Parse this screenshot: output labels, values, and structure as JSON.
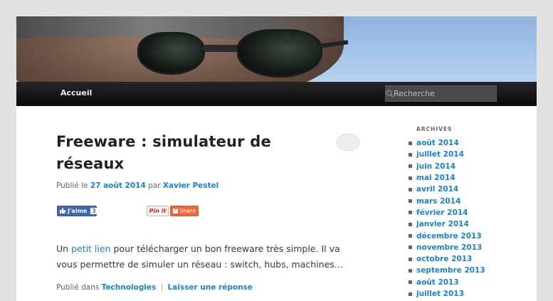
{
  "nav": {
    "home_label": "Accueil",
    "search_placeholder": "Recherche"
  },
  "post": {
    "title": "Freeware : simulateur de réseaux",
    "meta_prefix": "Publié le",
    "date": "27 août 2014",
    "by": "par",
    "author": "Xavier Pestel",
    "social": {
      "fb_label": "J'aime",
      "fb_count": "3",
      "pinit_label": "Pin it",
      "share_label": "Share"
    },
    "content_prefix": "Un",
    "content_link": "petit lien",
    "content_rest": "pour télécharger un bon freeware très simple. Il va vous permettre de simuler un réseau : switch, hubs, machines…",
    "footer_prefix": "Publié dans",
    "category": "Technologies",
    "separator": "|",
    "reply_label": "Laisser une réponse"
  },
  "sidebar": {
    "archives_title": "ARCHIVES",
    "archives": [
      "août 2014",
      "juillet 2014",
      "juin 2014",
      "mai 2014",
      "avril 2014",
      "mars 2014",
      "février 2014",
      "janvier 2014",
      "décembre 2013",
      "novembre 2013",
      "octobre 2013",
      "septembre 2013",
      "août 2013",
      "juillet 2013"
    ]
  },
  "colors": {
    "link": "#1982d1",
    "nav_bg": "#0a0a0a",
    "page_bg": "#e2e2e2"
  },
  "icons": {
    "search": "search-icon",
    "comment": "comment-bubble-icon",
    "like": "thumbs-up-icon"
  }
}
